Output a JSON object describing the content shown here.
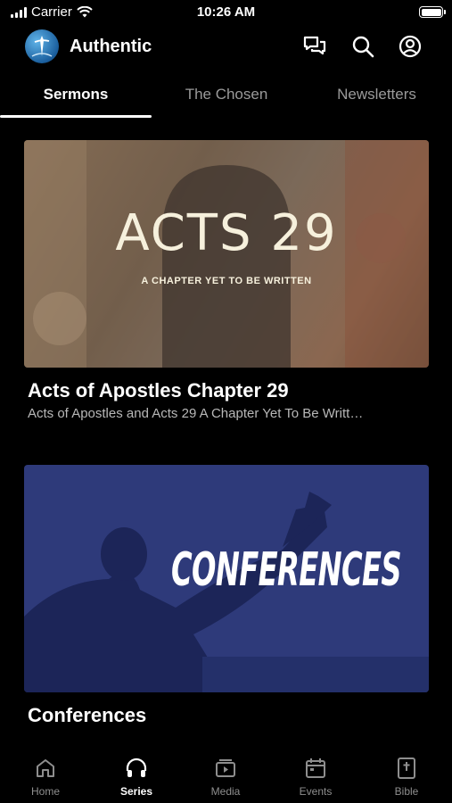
{
  "status_bar": {
    "carrier": "Carrier",
    "time": "10:26 AM",
    "battery_level": 1.0
  },
  "header": {
    "title": "Authentic",
    "icons": [
      "chat-icon",
      "search-icon",
      "profile-icon"
    ]
  },
  "tabs": [
    {
      "label": "Sermons",
      "active": true
    },
    {
      "label": "The Chosen",
      "active": false
    },
    {
      "label": "Newsletters",
      "active": false
    }
  ],
  "cards": [
    {
      "image_title": "ACTS 29",
      "image_subtitle": "A CHAPTER YET TO BE WRITTEN",
      "title": "Acts of Apostles Chapter 29",
      "subtitle": "Acts of Apostles and Acts 29 A Chapter Yet To Be Writt…"
    },
    {
      "image_title": "CONFERENCES",
      "title": "Conferences"
    }
  ],
  "bottom_nav": [
    {
      "label": "Home",
      "icon": "home-icon",
      "active": false
    },
    {
      "label": "Series",
      "icon": "headphones-icon",
      "active": true
    },
    {
      "label": "Media",
      "icon": "media-icon",
      "active": false
    },
    {
      "label": "Events",
      "icon": "calendar-icon",
      "active": false
    },
    {
      "label": "Bible",
      "icon": "bible-icon",
      "active": false
    }
  ],
  "colors": {
    "background": "#000000",
    "text": "#ffffff",
    "muted": "#9a9a9a",
    "conference_blue": "#2e3a7a"
  }
}
